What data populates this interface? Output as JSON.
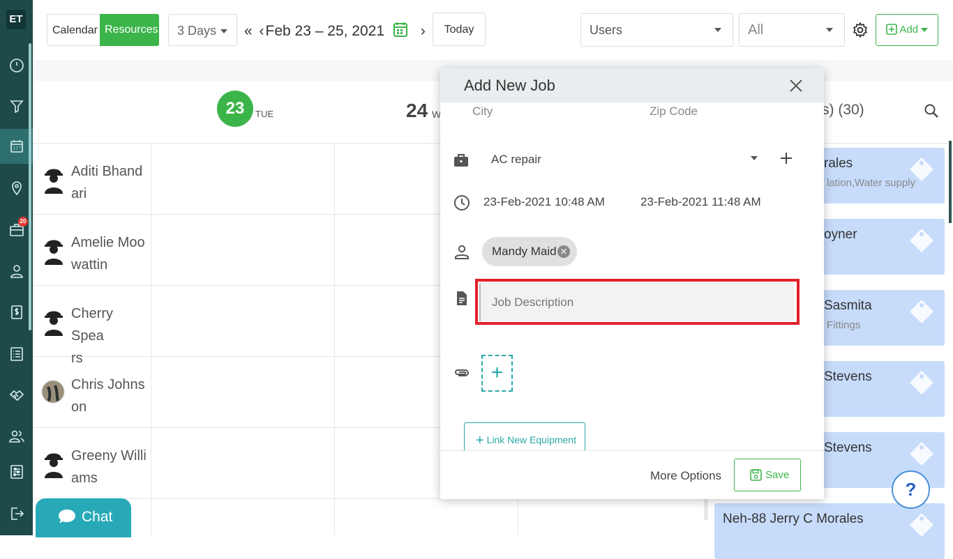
{
  "sidebar": {
    "logo": "ET",
    "badge_count": "20",
    "items": [
      {
        "name": "dashboard-icon"
      },
      {
        "name": "funnel-icon"
      },
      {
        "name": "calendar-icon"
      },
      {
        "name": "map-pin-icon"
      },
      {
        "name": "jobs-briefcase-icon"
      },
      {
        "name": "user-icon"
      },
      {
        "name": "invoice-dollar-icon"
      },
      {
        "name": "list-icon"
      },
      {
        "name": "handshake-icon"
      },
      {
        "name": "team-icon"
      },
      {
        "name": "settings-sliders-icon"
      },
      {
        "name": "logout-icon"
      }
    ]
  },
  "toolbar": {
    "calendar_tab": "Calendar",
    "resources_tab": "Resources",
    "days_select": "3 Days",
    "date_range": "Feb 23 – 25, 2021",
    "today_label": "Today",
    "users_select": "Users",
    "all_select": "All",
    "add_label": "Add"
  },
  "calendar": {
    "day1_num": "23",
    "day1_label": "TUE",
    "day2_num": "24",
    "day2_label": "W",
    "resources": [
      {
        "line1": "Aditi Bhand",
        "line2": "ari"
      },
      {
        "line1": "Amelie Moo",
        "line2": "wattin"
      },
      {
        "line1": "Cherry Spea",
        "line2": "rs"
      },
      {
        "line1": "Chris Johns",
        "line2": "on"
      },
      {
        "line1": "Greeny Willi",
        "line2": "ams"
      }
    ]
  },
  "unassigned": {
    "title": "s) (30)",
    "cards": [
      {
        "title": "rales",
        "sub": "lation,Water supply"
      },
      {
        "title": "oyner",
        "sub": ""
      },
      {
        "title": "Sasmita",
        "sub": "Fittings"
      },
      {
        "title": "Stevens",
        "sub": ""
      },
      {
        "title": "Stevens",
        "sub": ""
      },
      {
        "title": "Neh-88 Jerry C Morales",
        "sub": ""
      }
    ]
  },
  "modal": {
    "title": "Add New Job",
    "city_label": "City",
    "zip_label": "Zip Code",
    "job_type": "AC repair",
    "start_datetime": "23-Feb-2021 10:48 AM",
    "end_datetime": "23-Feb-2021 11:48 AM",
    "assignee": "Mandy Maid",
    "description_placeholder": "Job Description",
    "link_equipment": "Link New Equipment",
    "more_options": "More Options",
    "save_label": "Save"
  },
  "chat_label": "Chat",
  "help_label": "?",
  "colors": {
    "sidebar": "#1f4a4a",
    "brand_green": "#3bb54a",
    "teal": "#2aa7a7",
    "job_card": "#c7dcfb",
    "highlight_red": "#e3202a"
  }
}
